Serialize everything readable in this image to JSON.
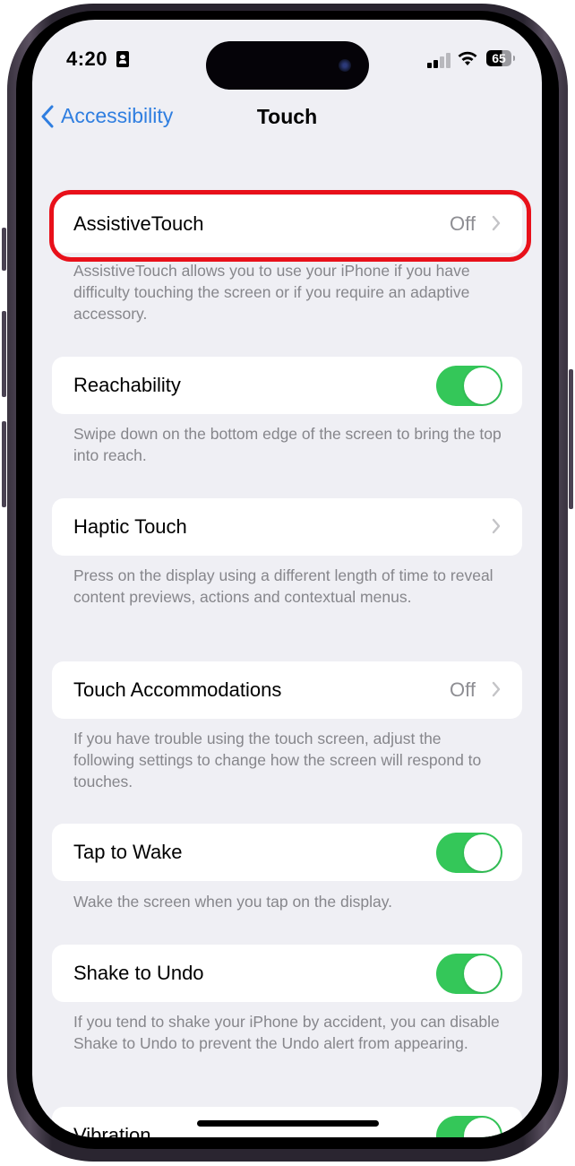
{
  "status_bar": {
    "time": "4:20",
    "battery": "65",
    "icons": [
      "id-card-icon",
      "signal-icon",
      "wifi-icon",
      "battery-icon"
    ]
  },
  "nav": {
    "back_label": "Accessibility",
    "title": "Touch"
  },
  "settings": [
    {
      "label": "AssistiveTouch",
      "value": "Off",
      "type": "link",
      "highlighted": true,
      "description": "AssistiveTouch allows you to use your iPhone if you have difficulty touching the screen or if you require an adaptive accessory."
    },
    {
      "label": "Reachability",
      "type": "toggle",
      "on": true,
      "description": "Swipe down on the bottom edge of the screen to bring the top into reach."
    },
    {
      "label": "Haptic Touch",
      "type": "link",
      "description": "Press on the display using a different length of time to reveal content previews, actions and contextual menus."
    },
    {
      "label": "Touch Accommodations",
      "value": "Off",
      "type": "link",
      "description": "If you have trouble using the touch screen, adjust the following settings to change how the screen will respond to touches."
    },
    {
      "label": "Tap to Wake",
      "type": "toggle",
      "on": true,
      "description": "Wake the screen when you tap on the display."
    },
    {
      "label": "Shake to Undo",
      "type": "toggle",
      "on": true,
      "description": "If you tend to shake your iPhone by accident, you can disable Shake to Undo to prevent the Undo alert from appearing."
    },
    {
      "label": "Vibration",
      "type": "toggle",
      "on": true
    }
  ],
  "colors": {
    "accent": "#2f7ee0",
    "toggle_on": "#34c759",
    "highlight": "#e8101a",
    "background": "#efeff4",
    "secondary_text": "#86868b"
  }
}
